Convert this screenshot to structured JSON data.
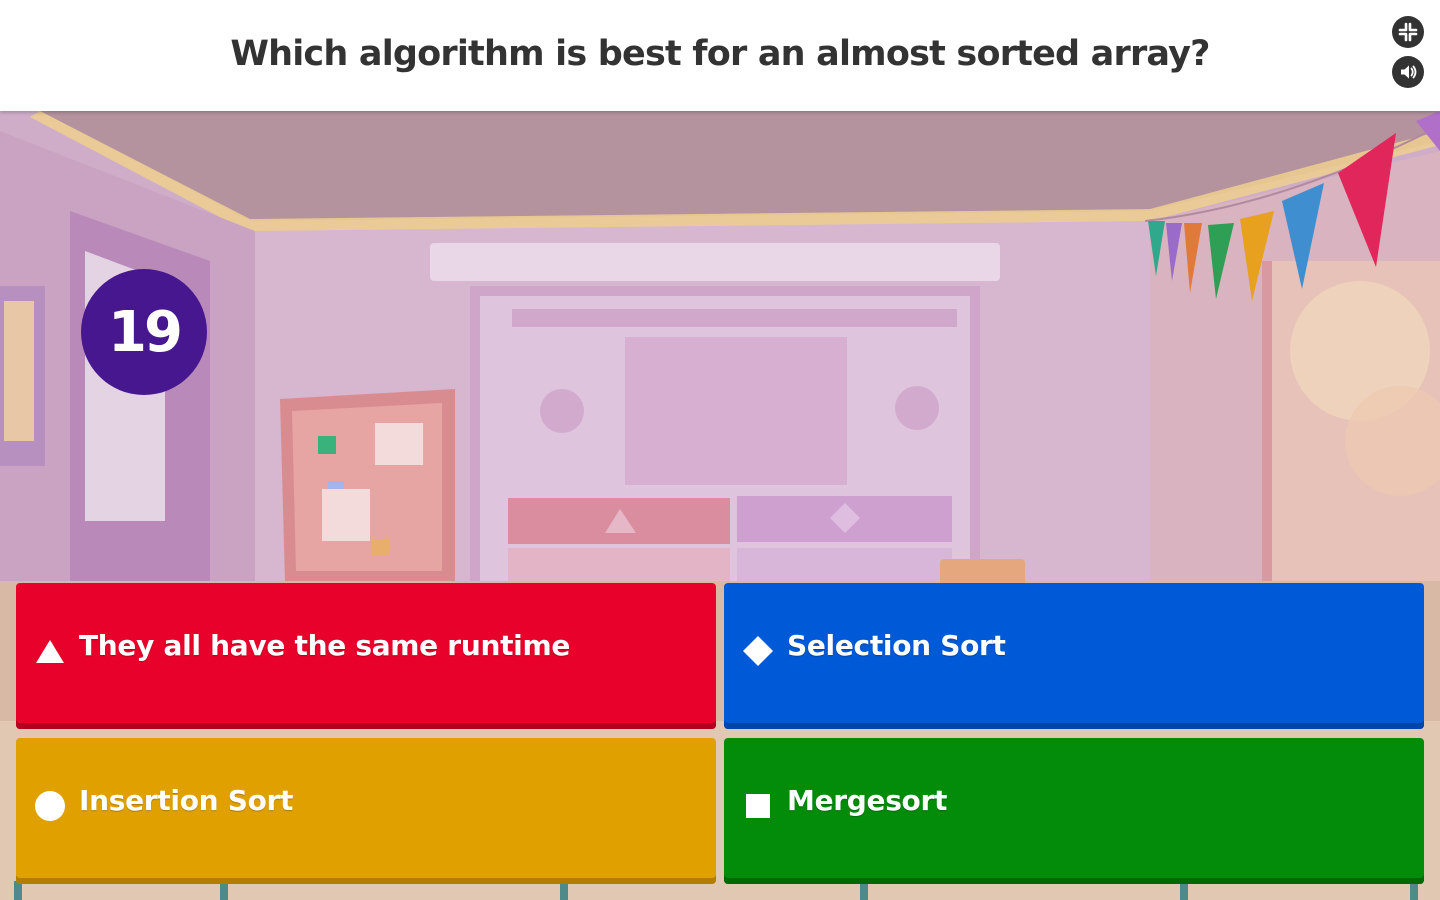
{
  "question": {
    "text": "Which algorithm is best for an almost sorted array?"
  },
  "controls": {
    "fullscreen_icon": "fullscreen-icon",
    "sound_icon": "speaker-icon"
  },
  "timer": {
    "value": "19"
  },
  "answers": [
    {
      "label": "They all have the same runtime",
      "shape": "triangle",
      "color": "#e8012a"
    },
    {
      "label": "Selection Sort",
      "shape": "diamond",
      "color": "#0059d6"
    },
    {
      "label": "Insertion Sort",
      "shape": "circle",
      "color": "#e0a100"
    },
    {
      "label": "Mergesort",
      "shape": "square",
      "color": "#028c0a"
    }
  ],
  "colors": {
    "timer_bg": "#46178f",
    "header_bg": "#ffffff",
    "question_text": "#333333"
  }
}
